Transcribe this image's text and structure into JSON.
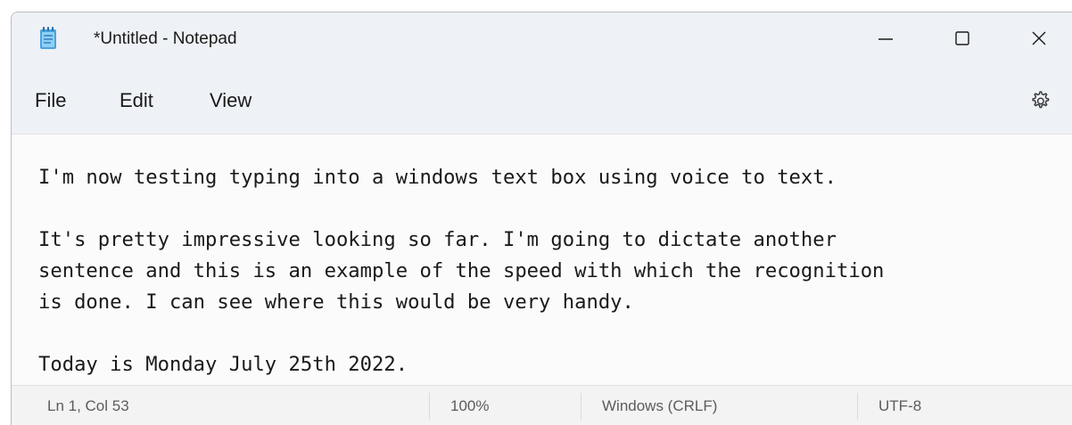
{
  "window": {
    "title": "*Untitled - Notepad",
    "app_icon": "notepad-icon",
    "controls": {
      "minimize": "minimize-icon",
      "maximize": "maximize-icon",
      "close": "close-icon"
    }
  },
  "menu": {
    "items": [
      {
        "label": "File"
      },
      {
        "label": "Edit"
      },
      {
        "label": "View"
      }
    ],
    "settings_icon": "gear-icon"
  },
  "editor": {
    "content": "I'm now testing typing into a windows text box using voice to text.\n\nIt's pretty impressive looking so far. I'm going to dictate another\nsentence and this is an example of the speed with which the recognition\nis done. I can see where this would be very handy.\n\nToday is Monday July 25th 2022."
  },
  "status": {
    "position": "Ln 1, Col 53",
    "zoom": "100%",
    "line_ending": "Windows (CRLF)",
    "encoding": "UTF-8"
  },
  "colors": {
    "titlebar": "#eef1f6",
    "editor_bg": "#fbfbfb",
    "statusbar": "#f3f3f3",
    "icon_accent": "#3c8fd8"
  }
}
